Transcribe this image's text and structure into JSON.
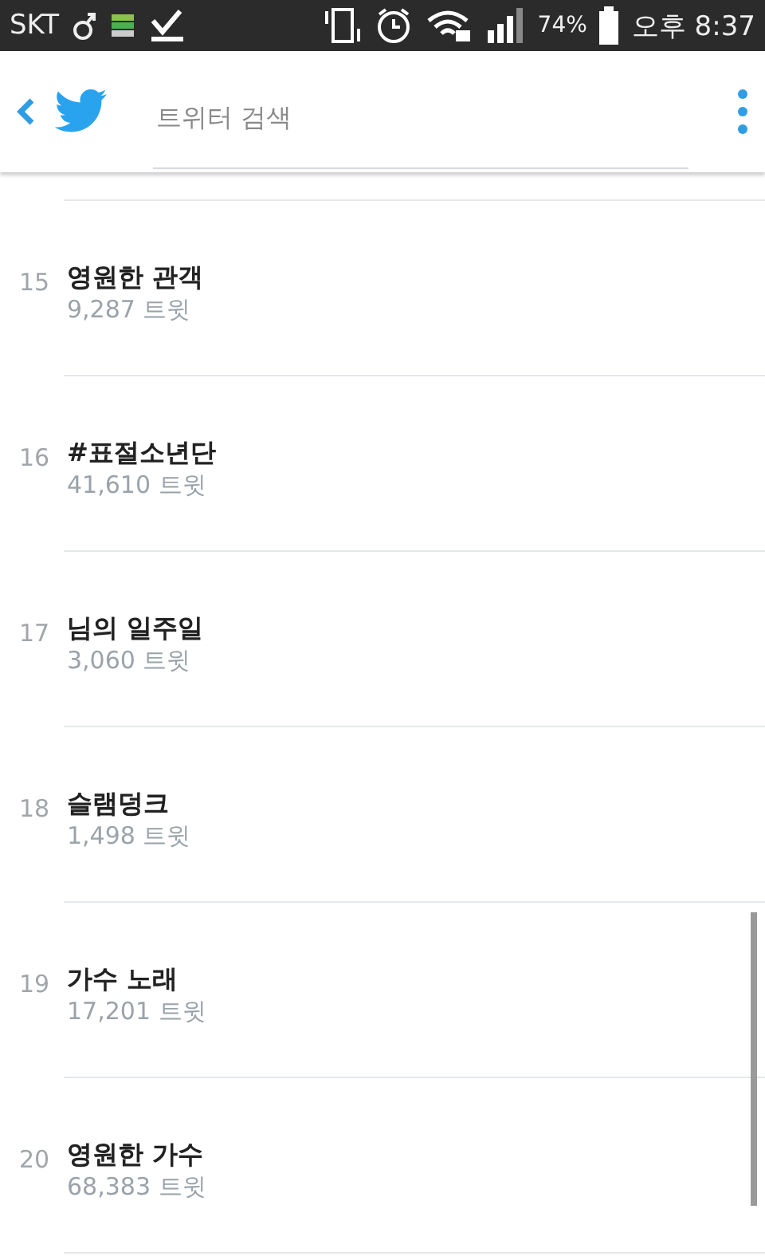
{
  "status_bar": {
    "carrier": "SKT",
    "battery": "74%",
    "time": "오후 8:37"
  },
  "search": {
    "placeholder": "트위터 검색"
  },
  "trends": [
    {
      "rank": "15",
      "name": "영원한 관객",
      "count": "9,287 트윗"
    },
    {
      "rank": "16",
      "name": "#표절소년단",
      "count": "41,610 트윗"
    },
    {
      "rank": "17",
      "name": "님의 일주일",
      "count": "3,060 트윗"
    },
    {
      "rank": "18",
      "name": "슬램덩크",
      "count": "1,498 트윗"
    },
    {
      "rank": "19",
      "name": "가수 노래",
      "count": "17,201 트윗"
    },
    {
      "rank": "20",
      "name": "영원한 가수",
      "count": "68,383 트윗"
    }
  ]
}
